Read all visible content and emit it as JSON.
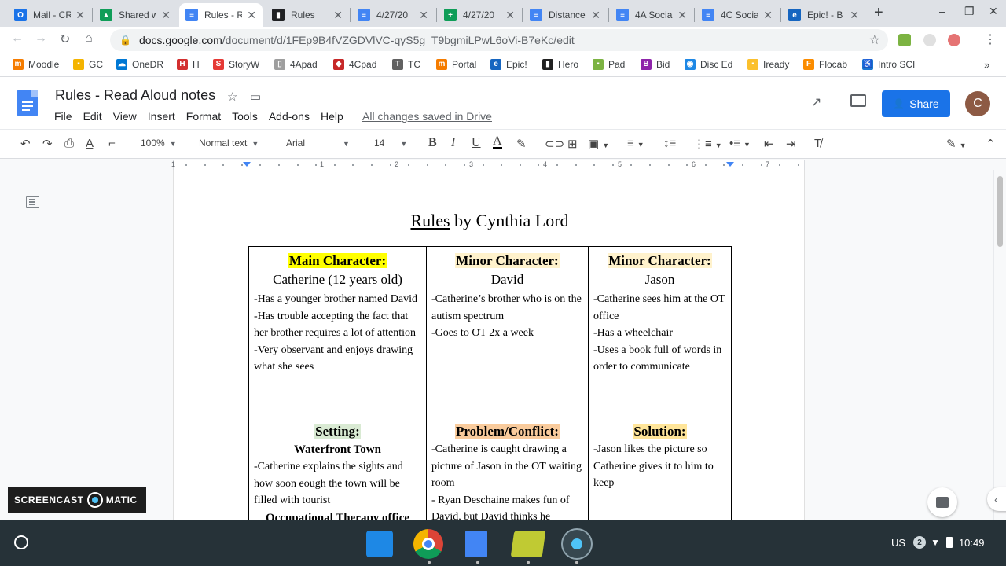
{
  "tabs": [
    {
      "title": "Mail - CR",
      "color": "#1a73e8",
      "glyph": "O"
    },
    {
      "title": "Shared w",
      "color": "#0f9d58",
      "glyph": "▲"
    },
    {
      "title": "Rules - R",
      "color": "#4285f4",
      "glyph": "≡",
      "active": true
    },
    {
      "title": "Rules",
      "color": "#202124",
      "glyph": "▮"
    },
    {
      "title": "4/27/20",
      "color": "#4285f4",
      "glyph": "≡"
    },
    {
      "title": "4/27/20",
      "color": "#0f9d58",
      "glyph": "+"
    },
    {
      "title": "Distance",
      "color": "#4285f4",
      "glyph": "≡"
    },
    {
      "title": "4A Socia",
      "color": "#4285f4",
      "glyph": "≡"
    },
    {
      "title": "4C Socia",
      "color": "#4285f4",
      "glyph": "≡"
    },
    {
      "title": "Epic! - B",
      "color": "#1565c0",
      "glyph": "e"
    }
  ],
  "address": {
    "host": "docs.google.com",
    "path": "/document/d/1FEp9B4fVZGDVlVC-qyS5g_T9bgmiLPwL6oVi-B7eKc/edit"
  },
  "bookmarks": [
    {
      "label": "Moodle",
      "color": "#f57c00",
      "glyph": "m"
    },
    {
      "label": "GC",
      "color": "#f4b400",
      "glyph": "▪"
    },
    {
      "label": "OneDR",
      "color": "#0078d4",
      "glyph": "☁"
    },
    {
      "label": "H",
      "color": "#d32f2f",
      "glyph": "H"
    },
    {
      "label": "StoryW",
      "color": "#e53935",
      "glyph": "S"
    },
    {
      "label": "4Apad",
      "color": "#9e9e9e",
      "glyph": "▯"
    },
    {
      "label": "4Cpad",
      "color": "#c62828",
      "glyph": "◆"
    },
    {
      "label": "TC",
      "color": "#616161",
      "glyph": "T"
    },
    {
      "label": "Portal",
      "color": "#f57c00",
      "glyph": "m"
    },
    {
      "label": "Epic!",
      "color": "#1565c0",
      "glyph": "e"
    },
    {
      "label": "Hero",
      "color": "#212121",
      "glyph": "▮"
    },
    {
      "label": "Pad",
      "color": "#7cb342",
      "glyph": "▪"
    },
    {
      "label": "Bid",
      "color": "#8e24aa",
      "glyph": "B"
    },
    {
      "label": "Disc Ed",
      "color": "#1e88e5",
      "glyph": "◉"
    },
    {
      "label": "Iready",
      "color": "#fbc02d",
      "glyph": "▪"
    },
    {
      "label": "Flocab",
      "color": "#fb8c00",
      "glyph": "F"
    },
    {
      "label": "Intro SCI",
      "color": "#1976d2",
      "glyph": "♿"
    }
  ],
  "docs": {
    "title": "Rules - Read Aloud notes",
    "menus": [
      "File",
      "Edit",
      "View",
      "Insert",
      "Format",
      "Tools",
      "Add-ons",
      "Help"
    ],
    "saved_status": "All changes saved in Drive",
    "share_label": "Share",
    "avatar_letter": "C"
  },
  "toolbar": {
    "zoom": "100%",
    "style": "Normal text",
    "font": "Arial",
    "size": "14"
  },
  "ruler": {
    "numbers": [
      "1",
      "1",
      "2",
      "3",
      "4",
      "5",
      "6",
      "7"
    ]
  },
  "document": {
    "heading_underlined": "Rules",
    "heading_rest": " by Cynthia Lord",
    "cells": {
      "main": {
        "header": "Main Character:",
        "name": "Catherine (12 years old)",
        "lines": [
          "-Has a younger brother named David",
          "-Has trouble accepting the fact that her brother requires a lot of attention",
          "-Very observant and enjoys drawing what she sees"
        ]
      },
      "minor1": {
        "header": "Minor Character:",
        "name": "David",
        "lines": [
          "-Catherine’s brother who is on the autism spectrum",
          "-Goes to OT 2x a week"
        ]
      },
      "minor2": {
        "header": "Minor Character:",
        "name": "Jason",
        "lines": [
          "-Catherine sees him at the OT office",
          "-Has a wheelchair",
          "-Uses a book full of words in order to communicate"
        ]
      },
      "setting": {
        "header": "Setting:",
        "sub1": "Waterfront Town",
        "line1": "-Catherine explains the sights and how soon eough the town will be filled with tourist",
        "sub2": "Occupational Therapy office"
      },
      "problem": {
        "header": "Problem/Conflict:",
        "lines": [
          "-Catherine is caught drawing a picture of Jason in the OT waiting room",
          "- Ryan Deschaine makes fun of David, but David thinks he"
        ]
      },
      "solution": {
        "header": "Solution:",
        "lines": [
          "-Jason likes the picture so Catherine gives it to him to keep"
        ]
      }
    }
  },
  "watermark": {
    "left": "SCREENCAST",
    "right": "MATIC"
  },
  "system": {
    "locale": "US",
    "notifications": "2",
    "time": "10:49"
  }
}
